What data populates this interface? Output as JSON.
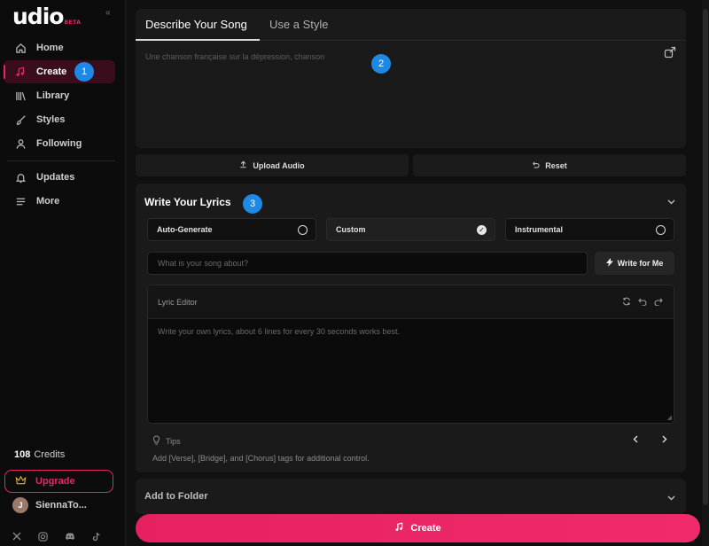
{
  "brand": {
    "name": "udio",
    "badge": "BETA",
    "accent": "#e8246a"
  },
  "sidebar": {
    "collapse": "«",
    "items": [
      {
        "label": "Home",
        "icon": "home-icon"
      },
      {
        "label": "Create",
        "icon": "music-note-icon",
        "active": true,
        "step": "1"
      },
      {
        "label": "Library",
        "icon": "library-icon"
      },
      {
        "label": "Styles",
        "icon": "brush-icon"
      },
      {
        "label": "Following",
        "icon": "person-icon"
      },
      {
        "label": "Updates",
        "icon": "bell-icon"
      },
      {
        "label": "More",
        "icon": "menu-icon"
      }
    ],
    "credits_count": "108",
    "credits_label": "Credits",
    "upgrade_label": "Upgrade",
    "user_initial": "J",
    "user_name": "SiennaTo...",
    "social": [
      "x-icon",
      "instagram-icon",
      "discord-icon",
      "tiktok-icon"
    ]
  },
  "tabs": [
    {
      "label": "Describe Your Song",
      "active": true
    },
    {
      "label": "Use a Style",
      "active": false
    }
  ],
  "prompt": {
    "placeholder": "Une chanson française sur la dépression, chanson",
    "step": "2"
  },
  "actions": {
    "upload_label": "Upload Audio",
    "reset_label": "Reset"
  },
  "lyrics": {
    "title": "Write Your Lyrics",
    "step": "3",
    "options": [
      {
        "label": "Auto-Generate",
        "selected": false
      },
      {
        "label": "Custom",
        "selected": true
      },
      {
        "label": "Instrumental",
        "selected": false
      }
    ],
    "about_placeholder": "What is your song about?",
    "write_button": "Write for Me",
    "editor_label": "Lyric Editor",
    "editor_placeholder": "Write your own lyrics, about 6 lines for every 30 seconds works best.",
    "tips_label": "Tips",
    "tip_text": "Add [Verse], [Bridge], and [Chorus] tags for additional control."
  },
  "folder": {
    "title": "Add to Folder"
  },
  "create_button": "Create"
}
